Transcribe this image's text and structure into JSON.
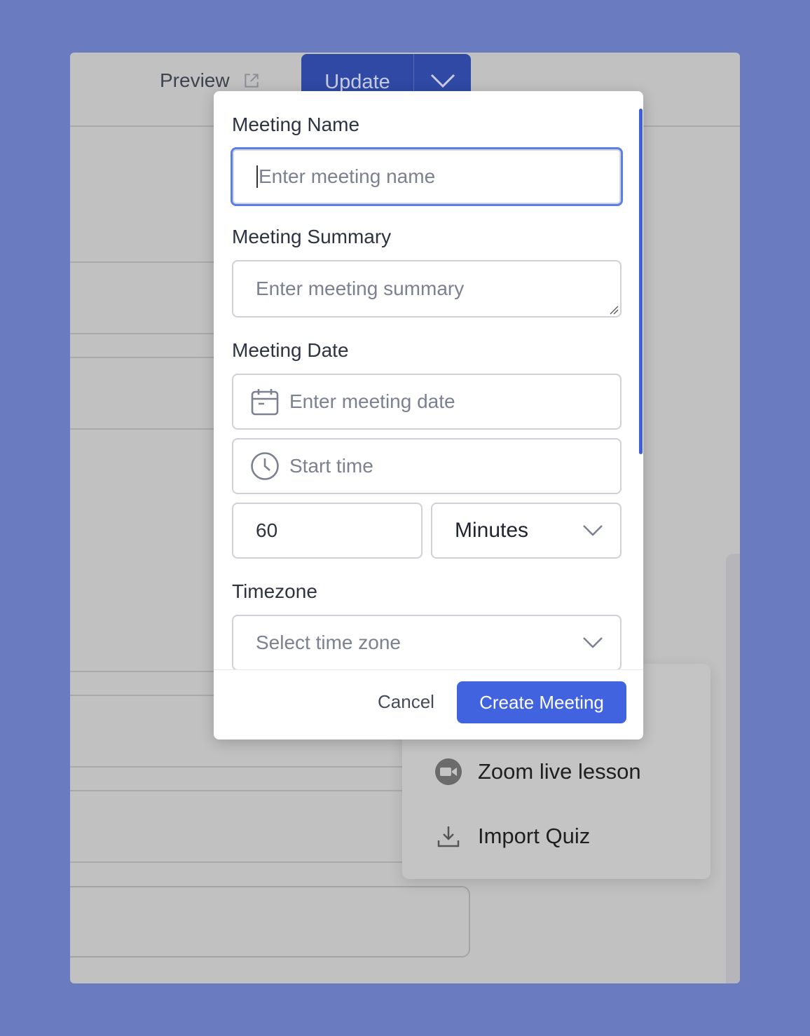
{
  "toolbar": {
    "preview_label": "Preview",
    "update_label": "Update"
  },
  "menu": {
    "items": [
      {
        "label": "Zoom live lesson",
        "icon": "video-camera-icon"
      },
      {
        "label": "Import Quiz",
        "icon": "download-icon"
      }
    ]
  },
  "modal": {
    "meeting_name": {
      "label": "Meeting Name",
      "placeholder": "Enter meeting name"
    },
    "meeting_summary": {
      "label": "Meeting Summary",
      "placeholder": "Enter meeting summary"
    },
    "meeting_date": {
      "label": "Meeting Date",
      "date_placeholder": "Enter meeting date",
      "time_placeholder": "Start time"
    },
    "duration": {
      "value": "60",
      "unit": "Minutes"
    },
    "timezone": {
      "label": "Timezone",
      "placeholder": "Select time zone"
    },
    "cancel_label": "Cancel",
    "create_label": "Create Meeting"
  },
  "colors": {
    "accent": "#4163df",
    "focus": "#5b7fe6",
    "backdrop": "#6a7bbf"
  }
}
